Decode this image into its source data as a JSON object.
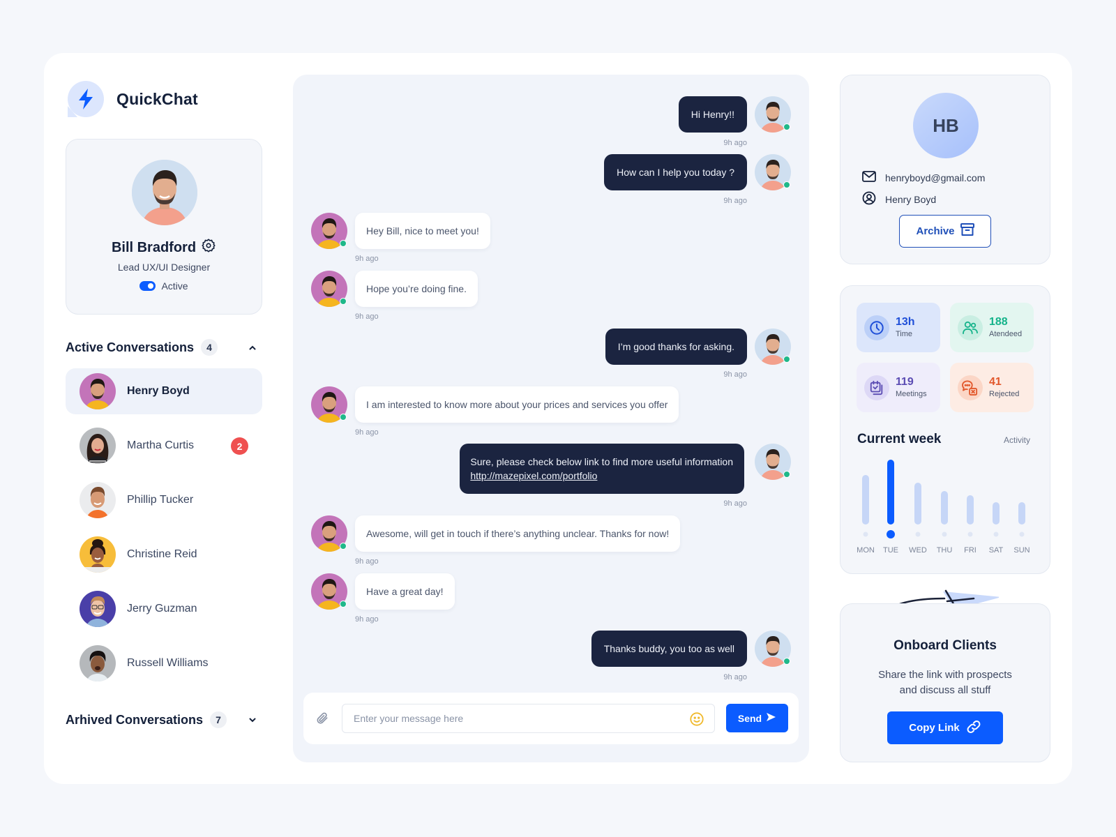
{
  "app": {
    "name": "QuickChat"
  },
  "user": {
    "name": "Bill Bradford",
    "role": "Lead UX/UI Designer",
    "status": "Active",
    "status_on": true
  },
  "active_conversations": {
    "title": "Active Conversations",
    "count": "4",
    "expanded": true,
    "items": [
      {
        "name": "Henry Boyd",
        "selected": true,
        "unread": ""
      },
      {
        "name": "Martha Curtis",
        "selected": false,
        "unread": "2"
      },
      {
        "name": "Phillip Tucker",
        "selected": false,
        "unread": ""
      },
      {
        "name": "Christine Reid",
        "selected": false,
        "unread": ""
      },
      {
        "name": "Jerry Guzman",
        "selected": false,
        "unread": ""
      },
      {
        "name": "Russell Williams",
        "selected": false,
        "unread": ""
      }
    ]
  },
  "archived_conversations": {
    "title": "Arhived Conversations",
    "count": "7",
    "expanded": false
  },
  "messages": [
    {
      "from": "me",
      "text": "Hi Henry!!",
      "time": "9h ago"
    },
    {
      "from": "me",
      "text": "How can I help you today ?",
      "time": "9h ago"
    },
    {
      "from": "them",
      "text": "Hey Bill, nice to meet you!",
      "time": "9h ago"
    },
    {
      "from": "them",
      "text": "Hope you’re doing fine.",
      "time": "9h ago"
    },
    {
      "from": "me",
      "text": "I’m good thanks for asking.",
      "time": "9h ago"
    },
    {
      "from": "them",
      "text": "I am interested to know more about your prices and services you offer",
      "time": "9h ago"
    },
    {
      "from": "me",
      "text": "Sure, please check below link to find more useful information",
      "link": "http://mazepixel.com/portfolio",
      "time": "9h ago"
    },
    {
      "from": "them",
      "text": "Awesome, will get in touch if there’s anything unclear. Thanks for now!",
      "time": "9h ago"
    },
    {
      "from": "them",
      "text": "Have a great day!",
      "time": "9h ago"
    },
    {
      "from": "me",
      "text": "Thanks buddy, you too as well",
      "time": "9h ago"
    }
  ],
  "composer": {
    "placeholder": "Enter your message here",
    "value": "",
    "send_label": "Send"
  },
  "contact": {
    "initials": "HB",
    "email": "henryboyd@gmail.com",
    "name": "Henry Boyd",
    "archive_label": "Archive"
  },
  "stats": [
    {
      "value": "13h",
      "label": "Time",
      "icon": "clock-icon",
      "color": "#1f4fd8",
      "bg": "#dce6fb",
      "icon_bg": "#bcd0f8"
    },
    {
      "value": "188",
      "label": "Atendeed",
      "icon": "users-icon",
      "color": "#14b38a",
      "bg": "#e3f6f0",
      "icon_bg": "#c9eee2"
    },
    {
      "value": "119",
      "label": "Meetings",
      "icon": "calendar-check-icon",
      "color": "#5b4cb3",
      "bg": "#efedfb",
      "icon_bg": "#ddd8f6"
    },
    {
      "value": "41",
      "label": "Rejected",
      "icon": "chat-rejected-icon",
      "color": "#e2582c",
      "bg": "#fdece4",
      "icon_bg": "#fbd6c6"
    }
  ],
  "week": {
    "title": "Current week",
    "link_label": "Activity"
  },
  "chart_data": {
    "type": "bar",
    "title": "Current week",
    "categories": [
      "MON",
      "TUE",
      "WED",
      "THU",
      "FRI",
      "SAT",
      "SUN"
    ],
    "values": [
      71,
      93,
      60,
      48,
      42,
      32,
      32
    ],
    "highlight": "TUE",
    "ylim": [
      0,
      100
    ],
    "xlabel": "",
    "ylabel": "",
    "grid": false,
    "colors": {
      "default": "#c6d6f7",
      "highlight": "#0b5cff"
    }
  },
  "onboard": {
    "title": "Onboard Clients",
    "desc_line1": "Share the link with prospects",
    "desc_line2": "and discuss all stuff",
    "button_label": "Copy Link"
  },
  "colors": {
    "accent": "#0b5cff",
    "dark_bubble": "#1b2440",
    "online": "#1fb88a",
    "unread": "#ef5050"
  }
}
